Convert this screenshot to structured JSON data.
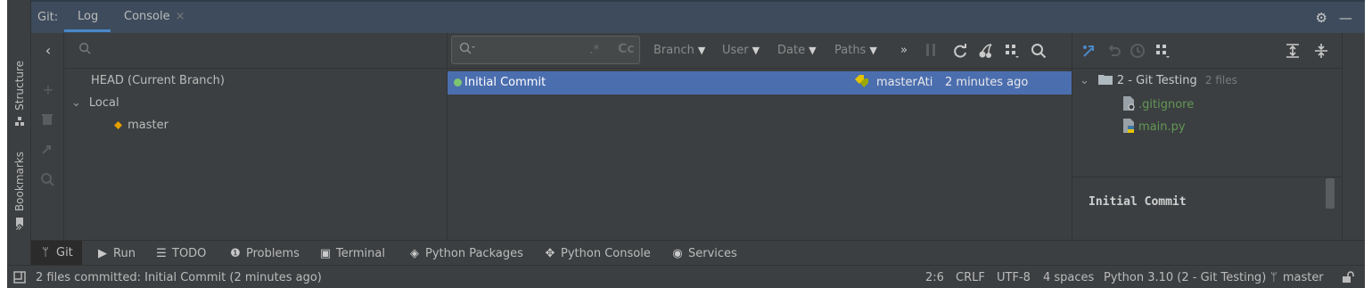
{
  "header": {
    "git_label": "Git:",
    "tabs": [
      {
        "label": "Log",
        "active": true
      },
      {
        "label": "Console",
        "closable": true,
        "close_glyph": "×"
      }
    ],
    "settings_icon": "⚙",
    "minimize_icon": "—"
  },
  "left_stripe": {
    "structure_label": "Structure",
    "bookmarks_label": "Bookmarks",
    "more": "»"
  },
  "branches": {
    "head_label": "HEAD (Current Branch)",
    "local_label": "Local",
    "branch": "master",
    "tools": [
      "back-icon",
      "add-icon",
      "delete-icon",
      "update-icon",
      "search-icon",
      "more-icon"
    ]
  },
  "log": {
    "search_placeholder": "",
    "regex_label": ".*",
    "case_label": "Cc",
    "filters": [
      "Branch",
      "User",
      "Date",
      "Paths"
    ],
    "more": "»",
    "commits": [
      {
        "message": "Initial Commit",
        "ref": "master",
        "author": "Ati",
        "time": "2 minutes ago"
      }
    ]
  },
  "changes": {
    "folder": "2 - Git Testing",
    "folder_count": "2 files",
    "files": [
      ".gitignore",
      "main.py"
    ]
  },
  "details": {
    "commit_title": "Initial Commit"
  },
  "bottom_tools": [
    {
      "label": "Git",
      "icon": "git-icon"
    },
    {
      "label": "Run",
      "icon": "run-icon"
    },
    {
      "label": "TODO",
      "icon": "todo-icon"
    },
    {
      "label": "Problems",
      "icon": "problems-icon"
    },
    {
      "label": "Terminal",
      "icon": "terminal-icon"
    },
    {
      "label": "Python Packages",
      "icon": "packages-icon"
    },
    {
      "label": "Python Console",
      "icon": "python-console-icon"
    },
    {
      "label": "Services",
      "icon": "services-icon"
    }
  ],
  "status": {
    "message": "2 files committed: Initial Commit (2 minutes ago)",
    "position": "2:6",
    "line_sep": "CRLF",
    "encoding": "UTF-8",
    "indent": "4 spaces",
    "interpreter": "Python 3.10 (2 - Git Testing)",
    "branch": "master"
  },
  "colors": {
    "accent": "#4a88c7",
    "selection": "#4b6eaf",
    "vcs_added": "#629755",
    "tag": "#e5c300"
  }
}
